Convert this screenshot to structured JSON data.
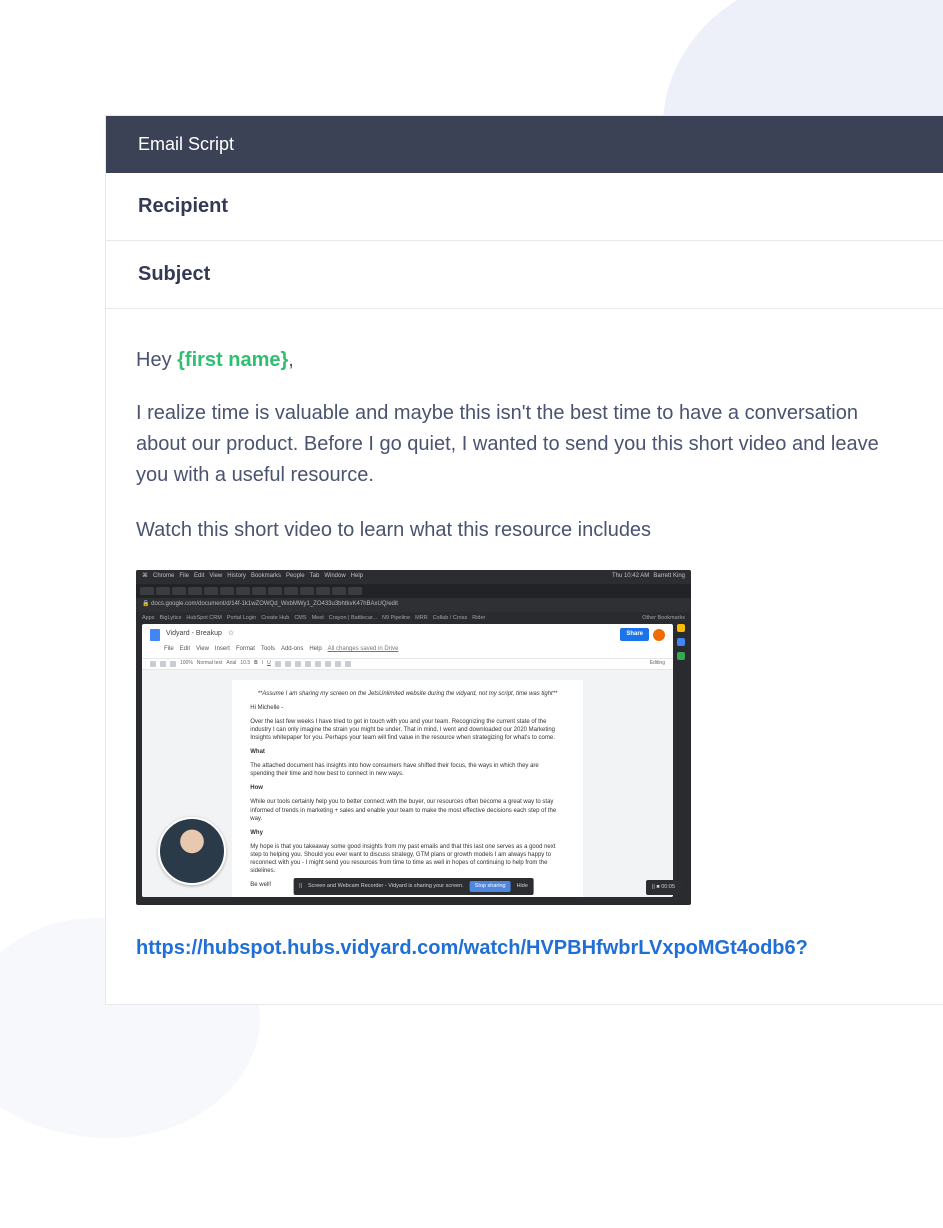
{
  "header": {
    "title": "Email Script"
  },
  "fields": {
    "recipient_label": "Recipient",
    "subject_label": "Subject"
  },
  "body": {
    "greeting_prefix": "Hey ",
    "greeting_token": "{first name}",
    "greeting_suffix": ",",
    "para1": "I realize time is valuable and maybe this isn't the best time to have a conversation about our product. Before I go quiet, I wanted to send you this short video and leave you with a useful resource.",
    "para2": "Watch this short video to learn what this resource includes",
    "link": "https://hubspot.hubs.vidyard.com/watch/HVPBHfwbrLVxpoMGt4odb6?"
  },
  "thumb": {
    "macmenu": [
      "Chrome",
      "File",
      "Edit",
      "View",
      "History",
      "Bookmarks",
      "People",
      "Tab",
      "Window",
      "Help"
    ],
    "mac_right": {
      "time": "Thu 10:42 AM",
      "user": "Barrett King"
    },
    "address": "docs.google.com/document/d/14f-1k1wZOWQd_WxbMWy1_ZO433u3bhtkvK47hBAxUQ/edit",
    "bookmarks": [
      "Apps",
      "BigLytics",
      "HubSpot CRM",
      "Portal Login",
      "Create Hub",
      "CMS",
      "Meet",
      "Crayon | Battlecar...",
      "N9 Pipeline",
      "MRR",
      "Collab / Cross",
      "Rider"
    ],
    "bookmarks_right": "Other Bookmarks",
    "doc_title": "Vidyard - Breakup",
    "doc_menus": [
      "File",
      "Edit",
      "View",
      "Insert",
      "Format",
      "Tools",
      "Add-ons",
      "Help"
    ],
    "doc_saved": "All changes saved in Drive",
    "share_label": "Share",
    "toolbar": {
      "zoom": "100%",
      "style": "Normal text",
      "font": "Arial",
      "size": "10.5",
      "mode": "Editing"
    },
    "doc_body": {
      "assume": "**Assume I am sharing my screen on the JetsUnlimited website during the vidyard, not my script, time was tight**",
      "hi": "Hi Michelle -",
      "p1": "Over the last few weeks I have tried to get in touch with you and your team. Recognizing the current state of the industry I can only imagine the strain you might be under. That in mind, I went and downloaded our 2020 Marketing Insights whitepaper for you. Perhaps your team will find value in the resource when strategizing for what's to come.",
      "what_h": "What",
      "what": "The attached document has insights into how consumers have shifted their focus, the ways in which they are spending their time and how best to connect in new ways.",
      "how_h": "How",
      "how": "While our tools certainly help you to better connect with the buyer, our resources often become a great way to stay informed of trends in marketing + sales and enable your team to make the most effective decisions each step of the way.",
      "why_h": "Why",
      "why": "My hope is that you takeaway some good insights from my past emails and that this last one serves as a good next step to helping you. Should you ever want to discuss strategy, GTM plans or growth models I am always happy to reconnect with you - I might send you resources from time to time as well in hopes of continuing to help from the sidelines.",
      "bye": "Be well!"
    },
    "sharebar": {
      "text": "Screen and Webcam Recorder - Vidyard is sharing your screen.",
      "stop": "Stop sharing",
      "hide": "Hide"
    },
    "timer": "00:05"
  }
}
